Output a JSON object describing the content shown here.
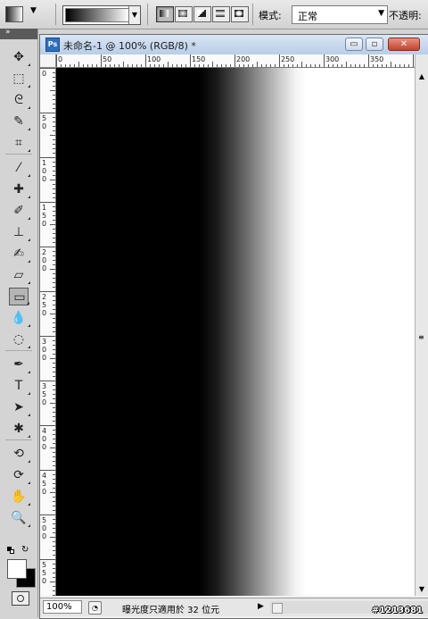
{
  "options_bar": {
    "mode_label": "模式:",
    "mode_value": "正常",
    "opacity_label": "不透明:",
    "gradient_types": [
      "linear",
      "radial",
      "angle",
      "reflected",
      "diamond"
    ],
    "active_gradient_type": "linear"
  },
  "toolbox": {
    "collapse_glyph": "»",
    "tools": [
      {
        "name": "move-tool",
        "glyph": "✥"
      },
      {
        "name": "marquee-tool",
        "glyph": "⬚"
      },
      {
        "name": "lasso-tool",
        "glyph": "ᘓ"
      },
      {
        "name": "quick-select-tool",
        "glyph": "✎"
      },
      {
        "name": "crop-tool",
        "glyph": "⌗"
      },
      {
        "name": "eyedropper-tool",
        "glyph": "⁄"
      },
      {
        "name": "healing-brush-tool",
        "glyph": "✚"
      },
      {
        "name": "brush-tool",
        "glyph": "✐"
      },
      {
        "name": "clone-stamp-tool",
        "glyph": "⊥"
      },
      {
        "name": "history-brush-tool",
        "glyph": "✍"
      },
      {
        "name": "eraser-tool",
        "glyph": "▱"
      },
      {
        "name": "gradient-tool",
        "glyph": "▭"
      },
      {
        "name": "blur-tool",
        "glyph": "💧"
      },
      {
        "name": "dodge-tool",
        "glyph": "◌"
      },
      {
        "name": "pen-tool",
        "glyph": "✒"
      },
      {
        "name": "type-tool",
        "glyph": "T"
      },
      {
        "name": "path-select-tool",
        "glyph": "➤"
      },
      {
        "name": "shape-tool",
        "glyph": "✱"
      },
      {
        "name": "3d-rotate-tool",
        "glyph": "⟲"
      },
      {
        "name": "3d-orbit-tool",
        "glyph": "⟳"
      },
      {
        "name": "hand-tool",
        "glyph": "✋"
      },
      {
        "name": "zoom-tool",
        "glyph": "🔍"
      }
    ],
    "selected_tool": "gradient-tool",
    "foreground_color": "#ffffff",
    "background_color": "#000000"
  },
  "document": {
    "icon_label": "Ps",
    "title": "未命名-1 @ 100% (RGB/8) *",
    "minimize_glyph": "▭",
    "maximize_glyph": "▫",
    "close_glyph": "✕",
    "ruler_h_labels": [
      "0",
      "50",
      "100",
      "150",
      "200",
      "250",
      "300",
      "350"
    ],
    "ruler_v_labels": [
      "0",
      "50",
      "100",
      "150",
      "200",
      "250",
      "300",
      "350",
      "400",
      "450",
      "500",
      "550"
    ]
  },
  "status_bar": {
    "zoom": "100%",
    "info_text": "曝光度只適用於 32 位元",
    "arrow": "▶"
  },
  "watermark": "#1213681"
}
